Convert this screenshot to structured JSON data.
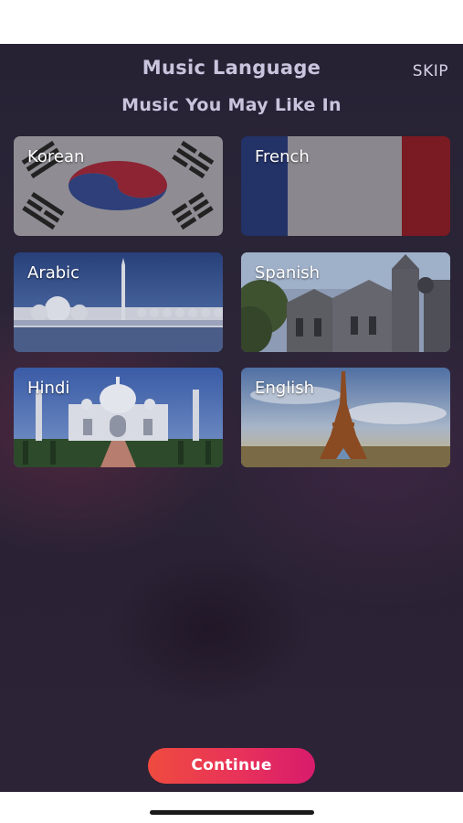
{
  "header": {
    "title": "Music Language",
    "skip_label": "SKIP",
    "subtitle": "Music You May Like In"
  },
  "languages": [
    {
      "label": "Korean",
      "image": "korean-flag"
    },
    {
      "label": "French",
      "image": "french-flag"
    },
    {
      "label": "Arabic",
      "image": "mosque-photo"
    },
    {
      "label": "Spanish",
      "image": "cathedral-photo"
    },
    {
      "label": "Hindi",
      "image": "taj-mahal-photo"
    },
    {
      "label": "English",
      "image": "eiffel-tower-photo"
    }
  ],
  "footer": {
    "continue_label": "Continue"
  },
  "colors": {
    "background": "#2a2234",
    "title_text": "#c9c4dd",
    "button_gradient_start": "#ef4b3f",
    "button_gradient_end": "#d81b6c"
  }
}
